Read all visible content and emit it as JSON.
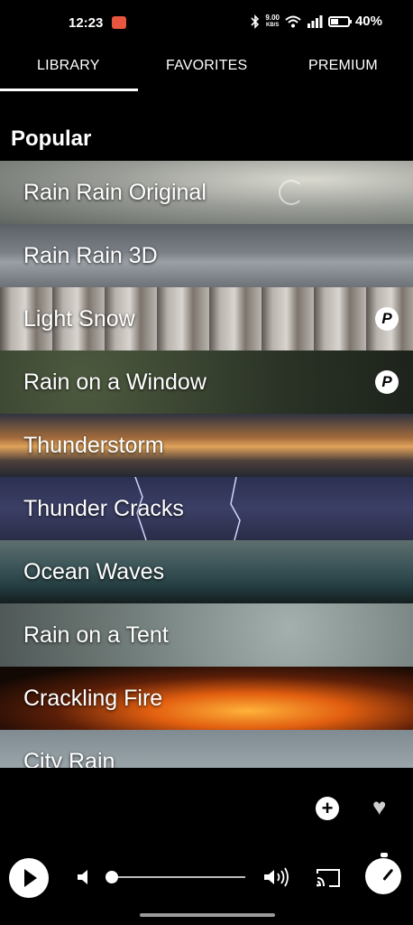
{
  "status_bar": {
    "time": "12:23",
    "net_speed_value": "9.00",
    "net_speed_unit": "KB/S",
    "battery": "40%"
  },
  "tabs": [
    {
      "label": "LIBRARY",
      "selected": true
    },
    {
      "label": "FAVORITES",
      "selected": false
    },
    {
      "label": "PREMIUM",
      "selected": false
    }
  ],
  "section_title": "Popular",
  "sounds": [
    {
      "label": "Rain Rain Original",
      "premium": false,
      "loading": true
    },
    {
      "label": "Rain Rain 3D",
      "premium": false,
      "loading": false
    },
    {
      "label": "Light Snow",
      "premium": true,
      "loading": false
    },
    {
      "label": "Rain on a Window",
      "premium": true,
      "loading": false
    },
    {
      "label": "Thunderstorm",
      "premium": false,
      "loading": false
    },
    {
      "label": "Thunder Cracks",
      "premium": false,
      "loading": false
    },
    {
      "label": "Ocean Waves",
      "premium": false,
      "loading": false
    },
    {
      "label": "Rain on a Tent",
      "premium": false,
      "loading": false
    },
    {
      "label": "Crackling Fire",
      "premium": false,
      "loading": false
    },
    {
      "label": "City Rain",
      "premium": false,
      "loading": false
    }
  ],
  "premium_badge": "P",
  "add_glyph": "+",
  "heart_glyph": "♥",
  "volume_level": 0.0,
  "colors": {
    "background": "#000000",
    "accent": "#ffffff",
    "status_app_icon": "#e8563f"
  },
  "icons": [
    "bluetooth-icon",
    "wifi-icon",
    "signal-icon",
    "battery-icon",
    "add-icon",
    "heart-icon",
    "play-icon",
    "volume-low-icon",
    "volume-high-icon",
    "cast-icon",
    "timer-icon"
  ]
}
